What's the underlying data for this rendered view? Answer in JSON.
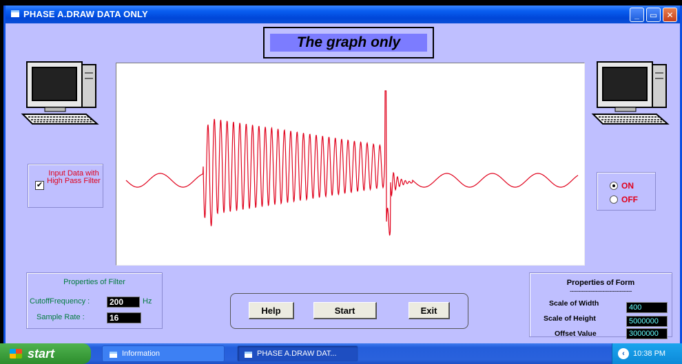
{
  "window": {
    "title": "PHASE A.DRAW DATA ONLY",
    "controls": {
      "minimize": "_",
      "maximize": "▭",
      "close": "✕"
    }
  },
  "heading": "The graph only",
  "filter_option": {
    "label": "Input Data with High Pass Filter",
    "checked": true,
    "check_glyph": "✔"
  },
  "toggle": {
    "on_label": "ON",
    "off_label": "OFF",
    "selected": "ON"
  },
  "properties_of_filter": {
    "title": "Properties of Filter",
    "cutoff_label": "CutoffFrequency :",
    "cutoff_value": "200",
    "cutoff_unit": "Hz",
    "sample_rate_label": "Sample Rate :",
    "sample_rate_value": "16"
  },
  "buttons": {
    "help": "Help",
    "start": "Start",
    "exit": "Exit"
  },
  "properties_of_form": {
    "title": "Properties of Form",
    "separator": "------------------------------------",
    "scale_width_label": "Scale of Width",
    "scale_width_value": "400",
    "scale_height_label": "Scale of Height",
    "scale_height_value": "5000000",
    "offset_label": "Offset Value",
    "offset_value": "3000000"
  },
  "taskbar": {
    "start_label": "start",
    "tasks": [
      "Information",
      "PHASE A.DRAW DAT..."
    ],
    "clock": "10:38 PM"
  },
  "colors": {
    "window_bg": "#bfbfff",
    "signal": "#e0001b",
    "heading_bg": "#7c7cff",
    "title_bar": "#0a5ef0"
  }
}
